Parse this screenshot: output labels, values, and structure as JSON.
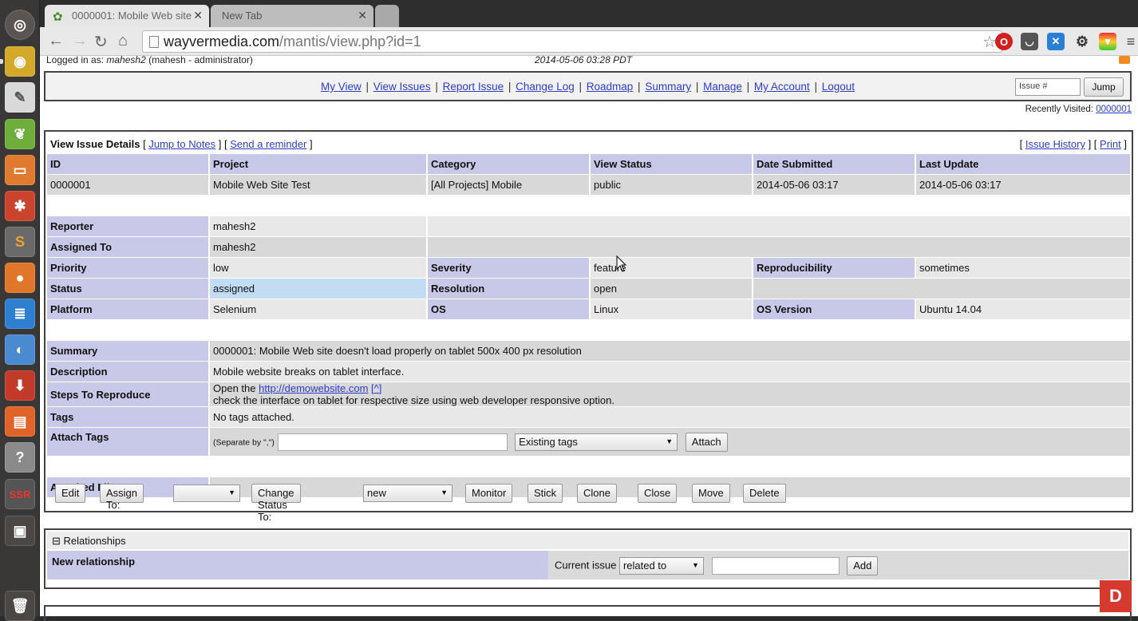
{
  "browser": {
    "tabs": [
      {
        "title": "0000001: Mobile Web site"
      },
      {
        "title": "New Tab"
      }
    ],
    "url_host": "wayvermedia.com",
    "url_path": "/mantis/view.php?id=1"
  },
  "header": {
    "logged_in_prefix": "Logged in as:",
    "username": "mahesh2",
    "user_detail": "(mahesh - administrator)",
    "current_time": "2014-05-06 03:28 PDT"
  },
  "menu": {
    "links": [
      "My View",
      "View Issues",
      "Report Issue",
      "Change Log",
      "Roadmap",
      "Summary",
      "Manage",
      "My Account",
      "Logout"
    ],
    "issue_placeholder": "Issue #",
    "jump_label": "Jump"
  },
  "recent": {
    "label": "Recently Visited:",
    "link": "0000001"
  },
  "details": {
    "title": "View Issue Details",
    "jump_to_notes": "Jump to Notes",
    "send_reminder": "Send a reminder",
    "issue_history": "Issue History",
    "print": "Print",
    "headers": [
      "ID",
      "Project",
      "Category",
      "View Status",
      "Date Submitted",
      "Last Update"
    ],
    "values": [
      "0000001",
      "Mobile Web Site Test",
      "[All Projects] Mobile",
      "public",
      "2014-05-06 03:17",
      "2014-05-06 03:17"
    ],
    "reporter_label": "Reporter",
    "reporter": "mahesh2",
    "assigned_label": "Assigned To",
    "assigned": "mahesh2",
    "priority_label": "Priority",
    "priority": "low",
    "severity_label": "Severity",
    "severity": "feature",
    "reproducibility_label": "Reproducibility",
    "reproducibility": "sometimes",
    "status_label": "Status",
    "status": "assigned",
    "resolution_label": "Resolution",
    "resolution": "open",
    "platform_label": "Platform",
    "platform": "Selenium",
    "os_label": "OS",
    "os": "Linux",
    "os_version_label": "OS Version",
    "os_version": "Ubuntu 14.04",
    "summary_label": "Summary",
    "summary": "0000001: Mobile Web site doesn't load properly on tablet 500x 400 px resolution",
    "description_label": "Description",
    "description": "Mobile website breaks on tablet interface.",
    "steps_label": "Steps To Reproduce",
    "steps_prefix": "Open the",
    "steps_link": "http://demowebsite.com",
    "steps_caret": "[^]",
    "steps_line2": "check the interface on tablet for respective size using web developer responsive option.",
    "tags_label": "Tags",
    "tags": "No tags attached.",
    "attach_tags_label": "Attach Tags",
    "separate_hint": "(Separate by \",\")",
    "existing_tags": "Existing tags",
    "attach_button": "Attach",
    "attached_files_label": "Attached Files"
  },
  "actions": {
    "edit": "Edit",
    "assign_to": "Assign To:",
    "change_status": "Change Status To:",
    "status_option": "new",
    "monitor": "Monitor",
    "stick": "Stick",
    "clone": "Clone",
    "close": "Close",
    "move": "Move",
    "delete": "Delete"
  },
  "relationships": {
    "title": "Relationships",
    "new_relationship": "New relationship",
    "current_issue": "Current issue",
    "relation_option": "related to",
    "add": "Add"
  },
  "watermark": "D",
  "colors": {
    "category_bg": "#c8c8e8",
    "link": "#2f3ec8",
    "assigned_bg": "#c2dcf4"
  }
}
